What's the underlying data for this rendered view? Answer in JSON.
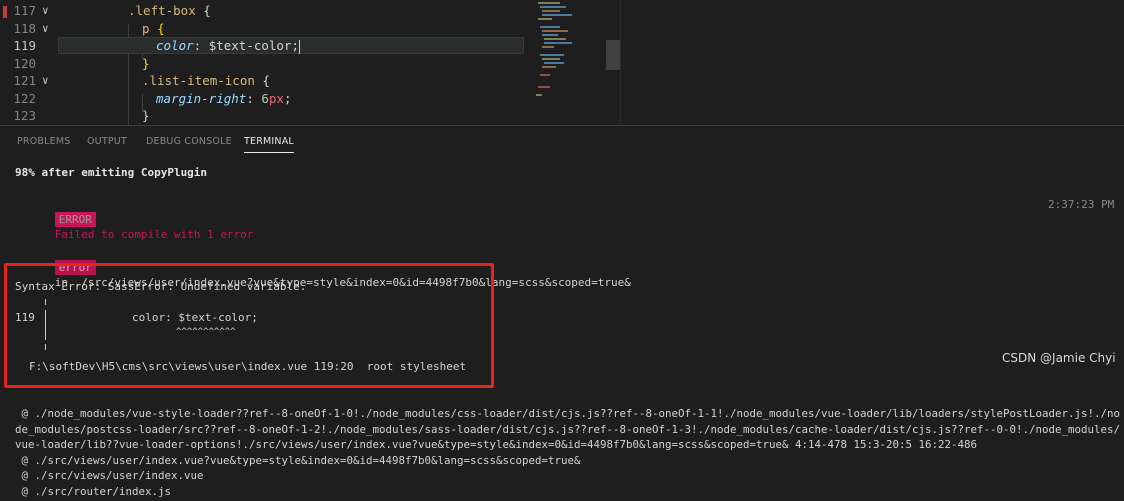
{
  "editor": {
    "lines": [
      {
        "num": "117",
        "fold": "∨",
        "tokens": [
          {
            "t": ".left-box",
            "c": "sel"
          },
          {
            "t": " ",
            "c": "punc"
          },
          {
            "t": "{",
            "c": "punc"
          }
        ],
        "indent": 1
      },
      {
        "num": "118",
        "fold": "∨",
        "tokens": [
          {
            "t": "p",
            "c": "tag"
          },
          {
            "t": " ",
            "c": "punc"
          },
          {
            "t": "{",
            "c": "brace"
          }
        ],
        "indent": 2
      },
      {
        "num": "119",
        "fold": "",
        "tokens": [
          {
            "t": "color",
            "c": "prop"
          },
          {
            "t": ": ",
            "c": "punc"
          },
          {
            "t": "$text-color",
            "c": "var"
          },
          {
            "t": ";",
            "c": "punc"
          }
        ],
        "indent": 3,
        "current": true
      },
      {
        "num": "120",
        "fold": "",
        "tokens": [
          {
            "t": "}",
            "c": "brace"
          }
        ],
        "indent": 2
      },
      {
        "num": "121",
        "fold": "∨",
        "tokens": [
          {
            "t": ".list-item-icon",
            "c": "sel"
          },
          {
            "t": " ",
            "c": "punc"
          },
          {
            "t": "{",
            "c": "punc"
          }
        ],
        "indent": 2
      },
      {
        "num": "122",
        "fold": "",
        "tokens": [
          {
            "t": "margin-right",
            "c": "prop"
          },
          {
            "t": ": ",
            "c": "punc"
          },
          {
            "t": "6",
            "c": "num"
          },
          {
            "t": "px",
            "c": "unit"
          },
          {
            "t": ";",
            "c": "punc"
          }
        ],
        "indent": 3
      },
      {
        "num": "123",
        "fold": "",
        "tokens": [
          {
            "t": "}",
            "c": "punc"
          }
        ],
        "indent": 2
      }
    ]
  },
  "panel": {
    "tabs": [
      {
        "label": "PROBLEMS",
        "active": false
      },
      {
        "label": "OUTPUT",
        "active": false
      },
      {
        "label": "DEBUG CONSOLE",
        "active": false
      },
      {
        "label": "TERMINAL",
        "active": true
      }
    ]
  },
  "terminal": {
    "progress": "98% after emitting CopyPlugin",
    "error_badge": "ERROR",
    "error_msg": "Failed to compile with 1 error",
    "timestamp": "2:37:23 PM",
    "error_badge_small": "error",
    "error_location": "in ./src/views/user/index.vue?vue&type=style&index=0&id=4498f7b0&lang=scss&scoped=true&",
    "syntax_error": "Syntax Error: SassError: Undefined variable.",
    "snippet_line_num": "119",
    "snippet_code": "color: $text-color;",
    "snippet_carets": "^^^^^^^^^^^",
    "file_ref": "F:\\softDev\\H5\\cms\\src\\views\\user\\index.vue 119:20  root stylesheet",
    "trace": [
      " @ ./node_modules/vue-style-loader??ref--8-oneOf-1-0!./node_modules/css-loader/dist/cjs.js??ref--8-oneOf-1-1!./node_modules/vue-loader/lib/loaders/stylePostLoader.js!./no",
      "de_modules/postcss-loader/src??ref--8-oneOf-1-2!./node_modules/sass-loader/dist/cjs.js??ref--8-oneOf-1-3!./node_modules/cache-loader/dist/cjs.js??ref--0-0!./node_modules/",
      "vue-loader/lib??vue-loader-options!./src/views/user/index.vue?vue&type=style&index=0&id=4498f7b0&lang=scss&scoped=true& 4:14-478 15:3-20:5 16:22-486",
      " @ ./src/views/user/index.vue?vue&type=style&index=0&id=4498f7b0&lang=scss&scoped=true&",
      " @ ./src/views/user/index.vue",
      " @ ./src/router/index.js"
    ]
  },
  "watermark": "CSDN @Jamie Chyi"
}
